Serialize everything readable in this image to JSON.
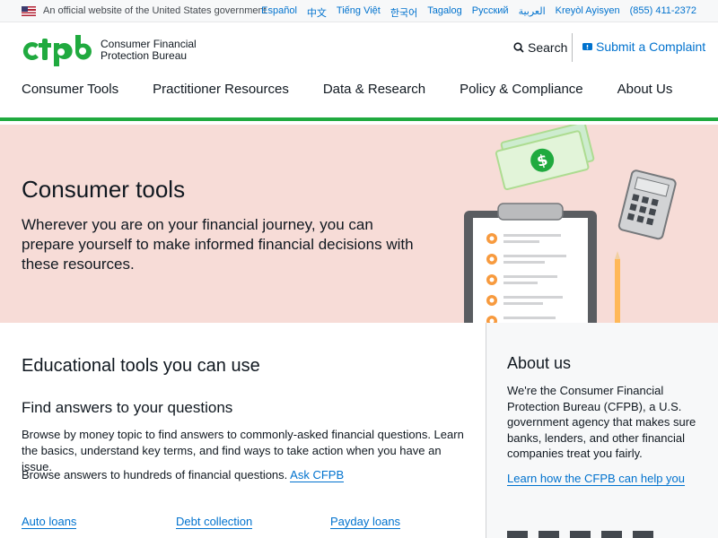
{
  "gov_banner": {
    "text": "An official website of the United States government",
    "languages": [
      "Español",
      "中文",
      "Tiếng Việt",
      "한국어",
      "Tagalog",
      "Русский",
      "العربية",
      "Kreyòl Ayisyen",
      "(855) 411-2372"
    ]
  },
  "header": {
    "logo_line1": "Consumer Financial",
    "logo_line2": "Protection Bureau",
    "search_label": "Search",
    "complaint_label": "Submit a Complaint",
    "nav": [
      "Consumer Tools",
      "Practitioner Resources",
      "Data & Research",
      "Policy & Compliance",
      "About Us"
    ]
  },
  "hero": {
    "title": "Consumer tools",
    "description": "Wherever you are on your financial journey, you can prepare yourself to make informed financial decisions with these resources."
  },
  "main": {
    "heading": "Educational tools you can use",
    "subheading": "Find answers to your questions",
    "paragraph": "Browse by money topic to find answers to commonly-asked financial questions. Learn the basics, understand key terms, and find ways to take action when you have an issue.",
    "browse_text": "Browse answers to hundreds of financial questions. ",
    "ask_link": "Ask CFPB",
    "topics": [
      "Auto loans",
      "Debt collection",
      "Payday loans"
    ]
  },
  "aside": {
    "title": "About us",
    "text": "We're the Consumer Financial Protection Bureau (CFPB), a U.S. government agency that makes sure banks, lenders, and other financial companies treat you fairly.",
    "link": "Learn how the CFPB can help you"
  },
  "colors": {
    "brand_green": "#20aa3f",
    "link_blue": "#0072ce",
    "hero_bg": "#f7dcd7"
  }
}
